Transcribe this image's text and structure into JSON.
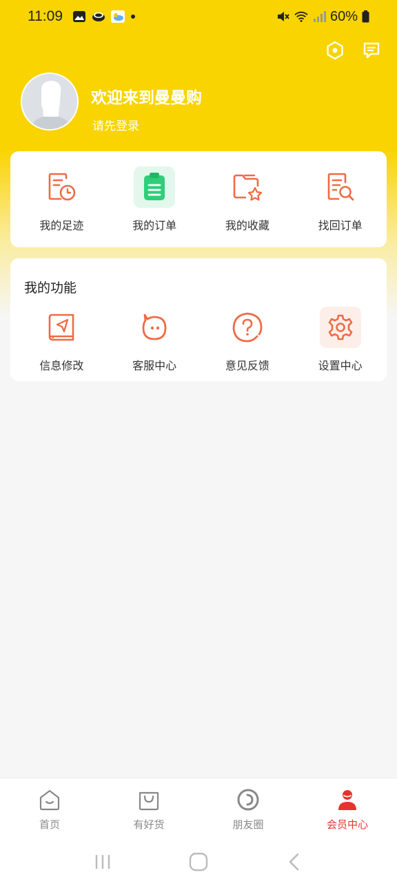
{
  "status_bar": {
    "time": "11:09",
    "battery": "60%",
    "icons": [
      "gallery-icon",
      "coins-icon",
      "weather-icon",
      "dot-icon",
      "mute-icon",
      "wifi-icon",
      "signal-icon",
      "battery-icon"
    ]
  },
  "header": {
    "actions": [
      "settings-hex-icon",
      "message-icon"
    ],
    "welcome": "欢迎来到曼曼购",
    "login_tip": "请先登录"
  },
  "orders": {
    "items": [
      {
        "label": "我的足迹",
        "icon": "footprint-icon"
      },
      {
        "label": "我的订单",
        "icon": "clipboard-icon"
      },
      {
        "label": "我的收藏",
        "icon": "favorite-folder-icon"
      },
      {
        "label": "找回订单",
        "icon": "search-order-icon"
      }
    ]
  },
  "functions": {
    "title": "我的功能",
    "items": [
      {
        "label": "信息修改",
        "icon": "book-edit-icon"
      },
      {
        "label": "客服中心",
        "icon": "chat-face-icon"
      },
      {
        "label": "意见反馈",
        "icon": "question-icon"
      },
      {
        "label": "设置中心",
        "icon": "gear-icon"
      }
    ]
  },
  "bottom_nav": {
    "items": [
      {
        "label": "首页",
        "icon": "home-icon"
      },
      {
        "label": "有好货",
        "icon": "shopping-bag-icon"
      },
      {
        "label": "朋友圈",
        "icon": "circle-icon"
      },
      {
        "label": "会员中心",
        "icon": "user-icon",
        "active": true
      }
    ]
  },
  "colors": {
    "brand_yellow": "#f9d400",
    "icon_orange": "#ee6b45",
    "active_red": "#e5342c",
    "order_green": "#2fcf7a"
  }
}
